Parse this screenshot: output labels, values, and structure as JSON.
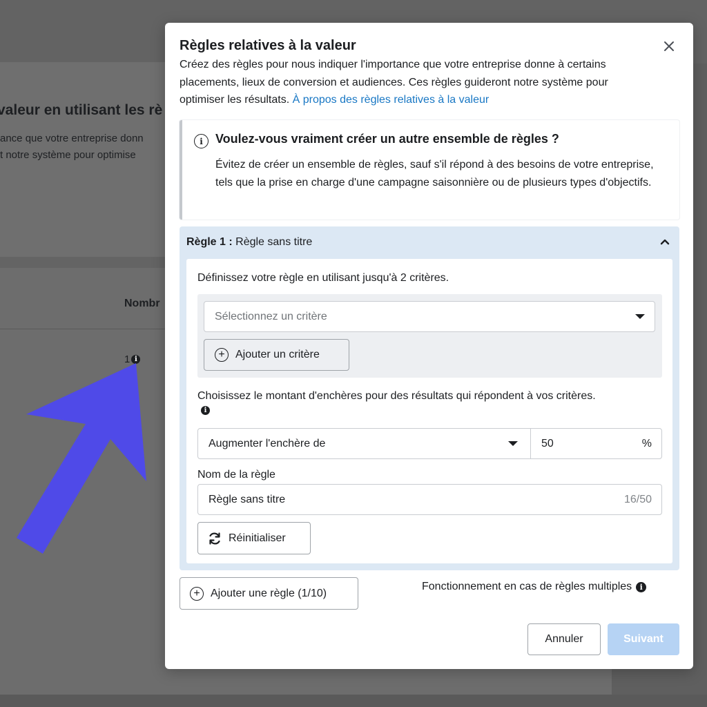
{
  "background": {
    "title": "valeur en utilisant les rè",
    "desc_line1": "ance que votre entreprise donn",
    "desc_line2": "t notre système pour optimise",
    "column_header": "Nombr",
    "row_count": "1"
  },
  "modal": {
    "title": "Règles relatives à la valeur",
    "description": "Créez des règles pour nous indiquer l'importance que votre entreprise donne à certains placements, lieux de conversion et audiences. Ces règles guideront notre système pour optimiser les résultats.",
    "description_link": "À propos des règles relatives à la valeur",
    "close_icon": "close-icon"
  },
  "warning": {
    "icon": "info-icon",
    "title": "Voulez-vous vraiment créer un autre ensemble de règles ?",
    "text": "Évitez de créer un ensemble de règles, sauf s'il répond à des besoins de votre entreprise, tels que la prise en charge d'une campagne saisonnière ou de plusieurs types d'objectifs."
  },
  "rule": {
    "header_prefix": "Règle 1 :",
    "header_name": "Règle sans titre",
    "criteria_label": "Définissez votre règle en utilisant jusqu'à 2 critères.",
    "criteria_placeholder": "Sélectionnez un critère",
    "add_criteria_label": "Ajouter un critère",
    "bid_label": "Choisissez le montant d'enchères pour des résultats qui répondent à vos critères.",
    "bid_action": "Augmenter l'enchère de",
    "bid_value": "50",
    "bid_unit": "%",
    "name_label": "Nom de la règle",
    "name_value": "Règle sans titre",
    "name_counter": "16/50",
    "reset_label": "Réinitialiser"
  },
  "footer": {
    "add_rule_label": "Ajouter une règle (1/10)",
    "multi_rules_label": "Fonctionnement en cas de règles multiples",
    "cancel_label": "Annuler",
    "next_label": "Suivant"
  },
  "colors": {
    "arrow": "#4f4ae8",
    "link": "#1877c4",
    "rule_panel": "#dce8f4",
    "next_disabled": "#b6d3f4"
  }
}
